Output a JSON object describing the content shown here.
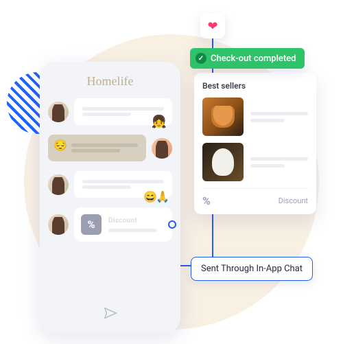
{
  "brand": "Homelife",
  "banner": {
    "text": "Check-out completed"
  },
  "bestsellers": {
    "title": "Best sellers",
    "discount_label": "Discount",
    "percent_glyph": "%"
  },
  "promo": {
    "label": "Discount",
    "percent_glyph": "%"
  },
  "callout": "Sent Through In-App Chat",
  "emojis": {
    "girl": "👧",
    "sad": "😔",
    "smile": "😄",
    "pray": "🙏"
  }
}
